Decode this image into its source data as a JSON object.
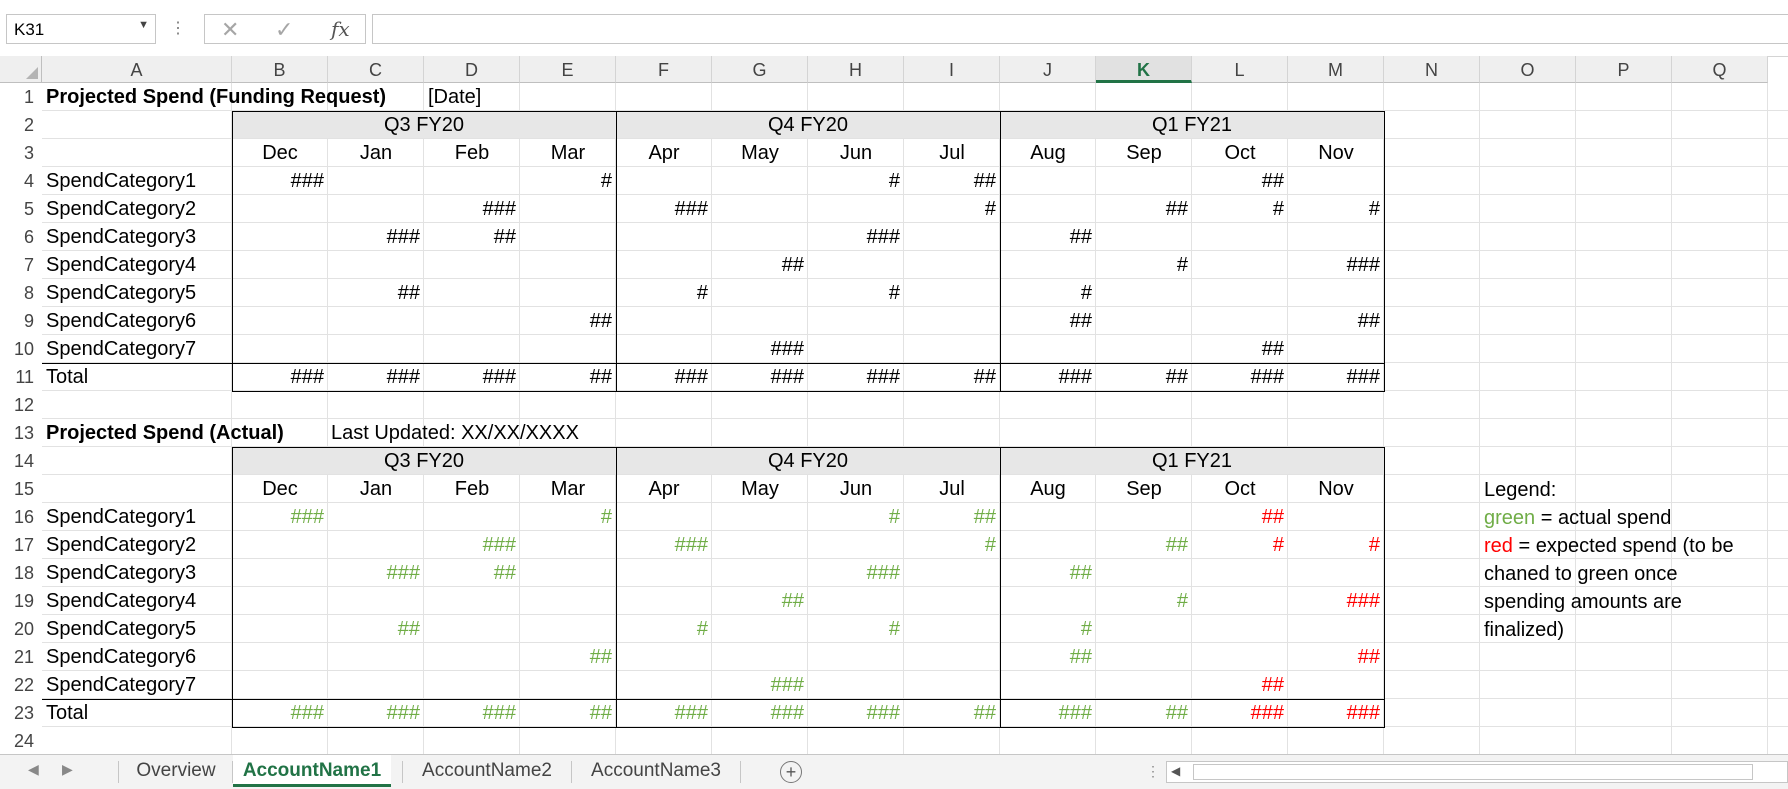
{
  "formula_bar": {
    "name_box": "K31",
    "cancel_icon": "✕",
    "enter_icon": "✓",
    "function_icon": "fx",
    "formula": ""
  },
  "columns": [
    "A",
    "B",
    "C",
    "D",
    "E",
    "F",
    "G",
    "H",
    "I",
    "J",
    "K",
    "L",
    "M",
    "N",
    "O",
    "P",
    "Q"
  ],
  "selected_column": "K",
  "rows": [
    "1",
    "2",
    "3",
    "4",
    "5",
    "6",
    "7",
    "8",
    "9",
    "10",
    "11",
    "12",
    "13",
    "14",
    "15",
    "16",
    "17",
    "18",
    "19",
    "20",
    "21",
    "22",
    "23",
    "24"
  ],
  "table1": {
    "title": "Projected Spend (Funding Request)",
    "subtitle": "[Date]",
    "quarters": [
      "Q3 FY20",
      "Q4 FY20",
      "Q1 FY21"
    ],
    "months": [
      "Dec",
      "Jan",
      "Feb",
      "Mar",
      "Apr",
      "May",
      "Jun",
      "Jul",
      "Aug",
      "Sep",
      "Oct",
      "Nov"
    ],
    "categories": [
      "SpendCategory1",
      "SpendCategory2",
      "SpendCategory3",
      "SpendCategory4",
      "SpendCategory5",
      "SpendCategory6",
      "SpendCategory7"
    ],
    "values": [
      [
        "###",
        "",
        "",
        "#",
        "",
        "",
        "#",
        "##",
        "",
        "",
        "##",
        ""
      ],
      [
        "",
        "",
        "###",
        "",
        "###",
        "",
        "",
        "#",
        "",
        "##",
        "#",
        "#"
      ],
      [
        "",
        "###",
        "##",
        "",
        "",
        "",
        "###",
        "",
        "##",
        "",
        "",
        ""
      ],
      [
        "",
        "",
        "",
        "",
        "",
        "##",
        "",
        "",
        "",
        "#",
        "",
        "###"
      ],
      [
        "",
        "##",
        "",
        "",
        "#",
        "",
        "#",
        "",
        "#",
        "",
        "",
        ""
      ],
      [
        "",
        "",
        "",
        "##",
        "",
        "",
        "",
        "",
        "##",
        "",
        "",
        "##"
      ],
      [
        "",
        "",
        "",
        "",
        "",
        "###",
        "",
        "",
        "",
        "",
        "##",
        ""
      ]
    ],
    "total_label": "Total",
    "totals": [
      "###",
      "###",
      "###",
      "##",
      "###",
      "###",
      "###",
      "##",
      "###",
      "##",
      "###",
      "###"
    ]
  },
  "table2": {
    "title": "Projected Spend (Actual)",
    "subtitle": "Last Updated: XX/XX/XXXX",
    "quarters": [
      "Q3 FY20",
      "Q4 FY20",
      "Q1 FY21"
    ],
    "months": [
      "Dec",
      "Jan",
      "Feb",
      "Mar",
      "Apr",
      "May",
      "Jun",
      "Jul",
      "Aug",
      "Sep",
      "Oct",
      "Nov"
    ],
    "categories": [
      "SpendCategory1",
      "SpendCategory2",
      "SpendCategory3",
      "SpendCategory4",
      "SpendCategory5",
      "SpendCategory6",
      "SpendCategory7"
    ],
    "values": [
      [
        "###",
        "",
        "",
        "#",
        "",
        "",
        "#",
        "##",
        "",
        "",
        "##",
        ""
      ],
      [
        "",
        "",
        "###",
        "",
        "###",
        "",
        "",
        "#",
        "",
        "##",
        "#",
        "#"
      ],
      [
        "",
        "###",
        "##",
        "",
        "",
        "",
        "###",
        "",
        "##",
        "",
        "",
        ""
      ],
      [
        "",
        "",
        "",
        "",
        "",
        "##",
        "",
        "",
        "",
        "#",
        "",
        "###"
      ],
      [
        "",
        "##",
        "",
        "",
        "#",
        "",
        "#",
        "",
        "#",
        "",
        "",
        ""
      ],
      [
        "",
        "",
        "",
        "##",
        "",
        "",
        "",
        "",
        "##",
        "",
        "",
        "##"
      ],
      [
        "",
        "",
        "",
        "",
        "",
        "###",
        "",
        "",
        "",
        "",
        "##",
        ""
      ]
    ],
    "colors": [
      [
        "g",
        "",
        "",
        "g",
        "",
        "",
        "g",
        "g",
        "",
        "",
        "r",
        ""
      ],
      [
        "",
        "",
        "g",
        "",
        "g",
        "",
        "",
        "g",
        "",
        "g",
        "r",
        "r"
      ],
      [
        "",
        "g",
        "g",
        "",
        "",
        "",
        "g",
        "",
        "g",
        "",
        "",
        ""
      ],
      [
        "",
        "",
        "",
        "",
        "",
        "g",
        "",
        "",
        "",
        "g",
        "",
        "r"
      ],
      [
        "",
        "g",
        "",
        "",
        "g",
        "",
        "g",
        "",
        "g",
        "",
        "",
        ""
      ],
      [
        "",
        "",
        "",
        "g",
        "",
        "",
        "",
        "",
        "g",
        "",
        "",
        "r"
      ],
      [
        "",
        "",
        "",
        "",
        "",
        "g",
        "",
        "",
        "",
        "",
        "r",
        ""
      ]
    ],
    "total_label": "Total",
    "totals": [
      "###",
      "###",
      "###",
      "##",
      "###",
      "###",
      "###",
      "##",
      "###",
      "##",
      "###",
      "###"
    ],
    "total_colors": [
      "g",
      "g",
      "g",
      "g",
      "g",
      "g",
      "g",
      "g",
      "g",
      "g",
      "r",
      "r"
    ]
  },
  "legend": {
    "title": "Legend:",
    "green_word": "green",
    "green_text": " = actual spend",
    "red_word": "red",
    "red_text": " = expected spend (to be",
    "line3": "chaned to green once",
    "line4": "spending amounts are",
    "line5": "finalized)"
  },
  "colors": {
    "green": "#70ad47",
    "red": "#ff0000",
    "accent": "#217346"
  },
  "sheet_tabs": [
    "Overview",
    "AccountName1",
    "AccountName2",
    "AccountName3"
  ],
  "active_sheet": "AccountName1"
}
